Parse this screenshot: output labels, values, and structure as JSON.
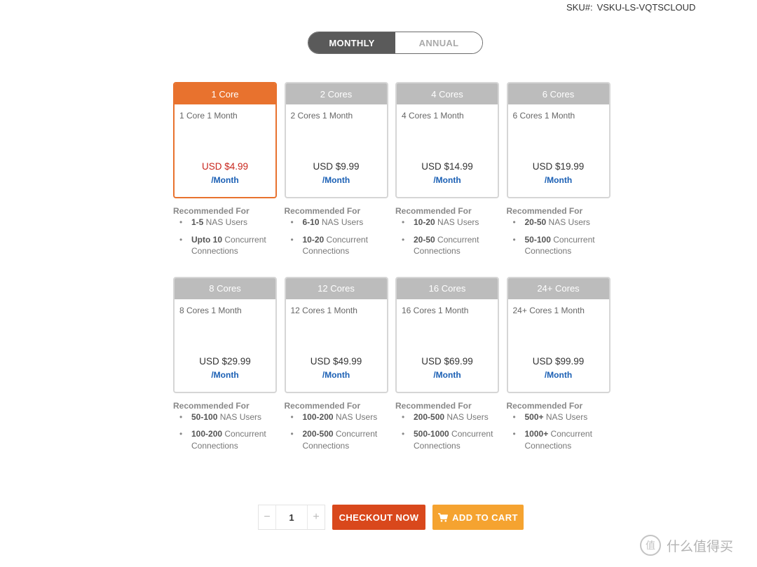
{
  "sku": {
    "label": "SKU#:",
    "value": "VSKU-LS-VQTSCLOUD"
  },
  "billing_toggle": {
    "monthly": "MONTHLY",
    "annual": "ANNUAL",
    "selected": "monthly"
  },
  "recommended_title": "Recommended For",
  "plans": [
    {
      "name": "1 Core",
      "desc": "1 Core 1 Month",
      "price": "USD $4.99",
      "period": "/Month",
      "selected": true,
      "rec": [
        {
          "bold": "1-5",
          "rest": " NAS Users"
        },
        {
          "bold": "Upto 10",
          "rest": " Concurrent Connections"
        }
      ]
    },
    {
      "name": "2 Cores",
      "desc": "2 Cores 1 Month",
      "price": "USD $9.99",
      "period": "/Month",
      "selected": false,
      "rec": [
        {
          "bold": "6-10",
          "rest": " NAS Users"
        },
        {
          "bold": "10-20",
          "rest": " Concurrent Connections"
        }
      ]
    },
    {
      "name": "4 Cores",
      "desc": "4 Cores 1 Month",
      "price": "USD $14.99",
      "period": "/Month",
      "selected": false,
      "rec": [
        {
          "bold": "10-20",
          "rest": " NAS Users"
        },
        {
          "bold": "20-50",
          "rest": " Concurrent Connections"
        }
      ]
    },
    {
      "name": "6 Cores",
      "desc": "6 Cores 1 Month",
      "price": "USD $19.99",
      "period": "/Month",
      "selected": false,
      "rec": [
        {
          "bold": "20-50",
          "rest": " NAS Users"
        },
        {
          "bold": "50-100",
          "rest": " Concurrent Connections"
        }
      ]
    },
    {
      "name": "8 Cores",
      "desc": "8 Cores 1 Month",
      "price": "USD $29.99",
      "period": "/Month",
      "selected": false,
      "rec": [
        {
          "bold": "50-100",
          "rest": " NAS Users"
        },
        {
          "bold": "100-200",
          "rest": " Concurrent Connections"
        }
      ]
    },
    {
      "name": "12 Cores",
      "desc": "12 Cores 1 Month",
      "price": "USD $49.99",
      "period": "/Month",
      "selected": false,
      "rec": [
        {
          "bold": "100-200",
          "rest": " NAS Users"
        },
        {
          "bold": "200-500",
          "rest": " Concurrent Connections"
        }
      ]
    },
    {
      "name": "16 Cores",
      "desc": "16 Cores 1 Month",
      "price": "USD $69.99",
      "period": "/Month",
      "selected": false,
      "rec": [
        {
          "bold": "200-500",
          "rest": " NAS Users"
        },
        {
          "bold": "500-1000",
          "rest": " Concurrent Connections"
        }
      ]
    },
    {
      "name": "24+ Cores",
      "desc": "24+ Cores 1 Month",
      "price": "USD $99.99",
      "period": "/Month",
      "selected": false,
      "rec": [
        {
          "bold": "500+",
          "rest": " NAS Users"
        },
        {
          "bold": "1000+",
          "rest": " Concurrent Connections"
        }
      ]
    }
  ],
  "quantity": {
    "value": "1",
    "minus": "−",
    "plus": "+"
  },
  "actions": {
    "checkout": "CHECKOUT NOW",
    "add_to_cart": "ADD TO CART"
  },
  "watermark": {
    "logo": "值",
    "text": "什么值得买"
  },
  "icons": {
    "cart": "cart-icon"
  },
  "colors": {
    "selected": "#e8722e",
    "checkout": "#d9481c",
    "cart": "#f5a330",
    "price_selected": "#c8251c",
    "period": "#1a5fb4"
  }
}
